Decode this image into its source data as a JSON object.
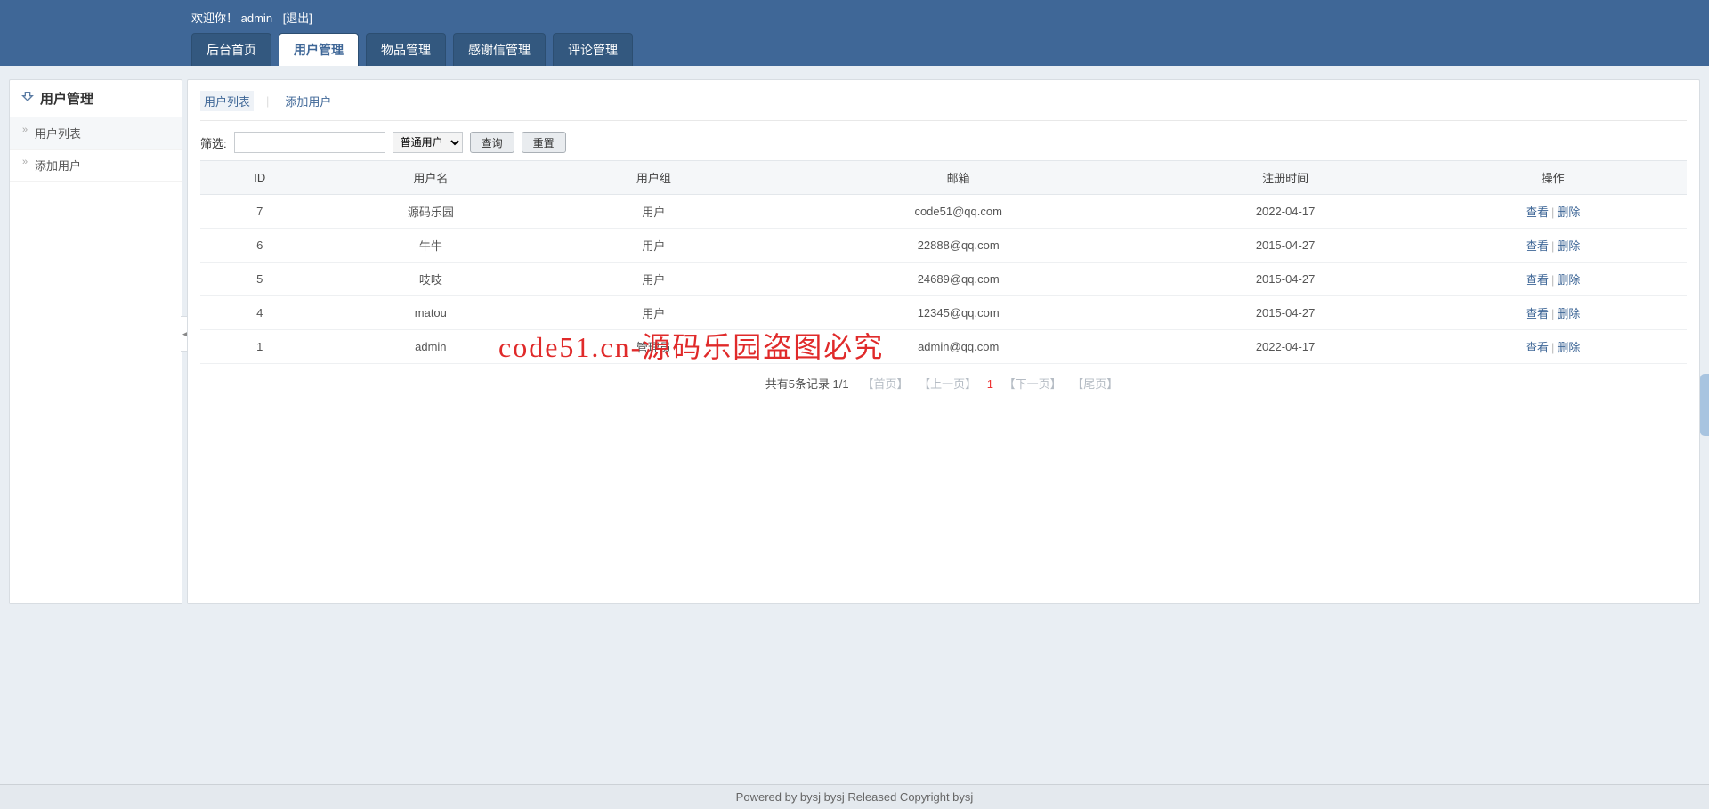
{
  "header": {
    "welcome_prefix": "欢迎你！",
    "username": "admin",
    "logout": "[退出]",
    "nav": [
      {
        "label": "后台首页",
        "active": false
      },
      {
        "label": "用户管理",
        "active": true
      },
      {
        "label": "物品管理",
        "active": false
      },
      {
        "label": "感谢信管理",
        "active": false
      },
      {
        "label": "评论管理",
        "active": false
      }
    ]
  },
  "sidebar": {
    "title": "用户管理",
    "items": [
      {
        "label": "用户列表"
      },
      {
        "label": "添加用户"
      }
    ]
  },
  "subtabs": [
    {
      "label": "用户列表",
      "active": true
    },
    {
      "label": "添加用户",
      "active": false
    }
  ],
  "filter": {
    "label": "筛选:",
    "input_value": "",
    "select_options": [
      "普通用户"
    ],
    "selected": "普通用户",
    "query_btn": "查询",
    "reset_btn": "重置"
  },
  "table": {
    "columns": [
      "ID",
      "用户名",
      "用户组",
      "邮箱",
      "注册时间",
      "操作"
    ],
    "action_view": "查看",
    "action_delete": "删除",
    "rows": [
      {
        "id": "7",
        "username": "源码乐园",
        "group": "用户",
        "email": "code51@qq.com",
        "regtime": "2022-04-17"
      },
      {
        "id": "6",
        "username": "牛牛",
        "group": "用户",
        "email": "22888@qq.com",
        "regtime": "2015-04-27"
      },
      {
        "id": "5",
        "username": "吱吱",
        "group": "用户",
        "email": "24689@qq.com",
        "regtime": "2015-04-27"
      },
      {
        "id": "4",
        "username": "matou",
        "group": "用户",
        "email": "12345@qq.com",
        "regtime": "2015-04-27"
      },
      {
        "id": "1",
        "username": "admin",
        "group": "管理员",
        "email": "admin@qq.com",
        "regtime": "2022-04-17"
      }
    ]
  },
  "pagination": {
    "summary": "共有5条记录  1/1",
    "first": "【首页】",
    "prev": "【上一页】",
    "current": "1",
    "next": "【下一页】",
    "last": "【尾页】"
  },
  "watermark": "code51.cn-源码乐园盗图必究",
  "footer": "Powered by bysj bysj Released  Copyright bysj",
  "collapse_arrow": "◀"
}
